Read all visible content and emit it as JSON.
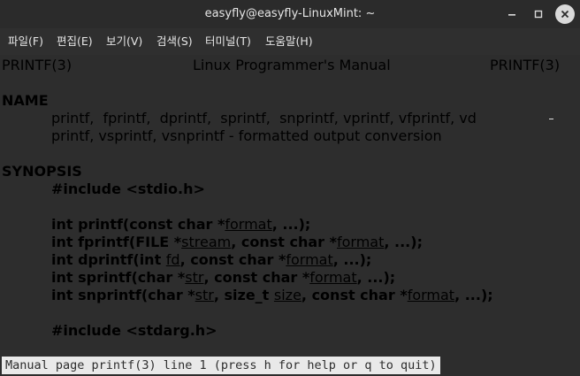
{
  "window": {
    "title": "easyfly@easyfly-LinuxMint: ~",
    "controls": [
      "minimize-icon",
      "maximize-icon",
      "close-icon"
    ]
  },
  "menu": [
    {
      "label": "파일(F)"
    },
    {
      "label": "편집(E)"
    },
    {
      "label": "보기(V)"
    },
    {
      "label": "검색(S)"
    },
    {
      "label": "터미널(T)"
    },
    {
      "label": "도움말(H)"
    }
  ],
  "man": {
    "header_left": "PRINTF(3)",
    "header_center": "Linux Programmer's Manual",
    "header_right": "PRINTF(3)",
    "name_heading": "NAME",
    "name_line1": "printf,  fprintf,  dprintf,  sprintf,  snprintf, vprintf, vfprintf, vd",
    "name_line2": "printf, vsprintf, vsnprintf - formatted output conversion",
    "synopsis_heading": "SYNOPSIS",
    "include1": "#include <stdio.h>",
    "proto": {
      "p1": {
        "a": "int printf(const char *",
        "u1": "format",
        "b": ", ...);"
      },
      "p2": {
        "a": "int fprintf(FILE *",
        "u1": "stream",
        "b": ", const char *",
        "u2": "format",
        "c": ", ...);"
      },
      "p3": {
        "a": "int dprintf(int ",
        "u1": "fd",
        "b": ", const char *",
        "u2": "format",
        "c": ", ...);"
      },
      "p4": {
        "a": "int sprintf(char *",
        "u1": "str",
        "b": ", const char *",
        "u2": "format",
        "c": ", ...);"
      },
      "p5": {
        "a": "int snprintf(char *",
        "u1": "str",
        "b": ", size_t ",
        "u2": "size",
        "c": ", const char *",
        "u3": "format",
        "d": ", ...);"
      }
    },
    "include2": "#include <stdarg.h>",
    "status": "Manual page printf(3) line 1 (press h for help or q to quit)"
  },
  "colors": {
    "terminal_bg": "#2d2d2d",
    "terminal_fg": "#e3e3e3",
    "titlebar_bg": "#2b2b2b",
    "status_bg": "#e9e9e9"
  }
}
